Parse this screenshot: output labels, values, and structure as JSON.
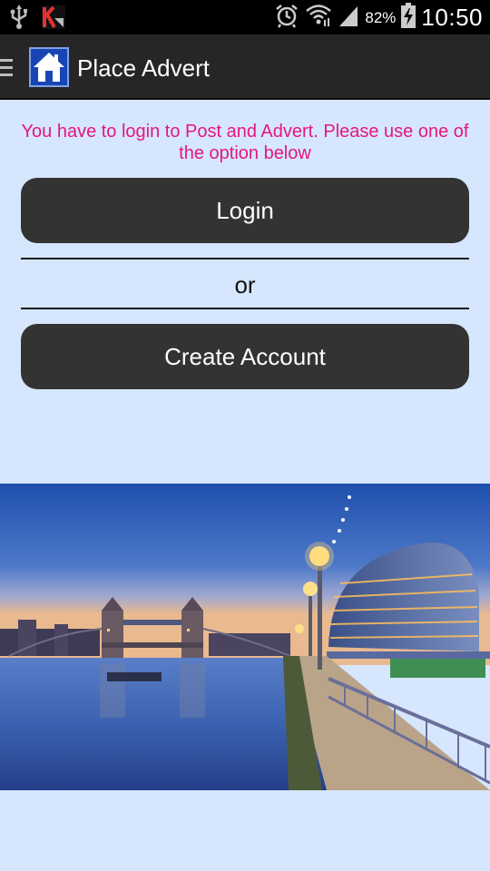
{
  "status_bar": {
    "battery_percent": "82%",
    "time": "10:50",
    "icons": [
      "usb-icon",
      "kaspersky-icon",
      "alarm-icon",
      "wifi-icon",
      "signal-icon",
      "battery-charging-icon"
    ]
  },
  "action_bar": {
    "title": "Place Advert",
    "icons": [
      "menu-icon",
      "home-icon"
    ]
  },
  "main": {
    "notice": "You have to login to Post and Advert. Please use one of the option below",
    "login_label": "Login",
    "or_label": "or",
    "create_account_label": "Create Account"
  },
  "colors": {
    "background": "#d6e6fc",
    "notice_text": "#e5177c",
    "button_bg": "#333333",
    "action_bar_bg": "#262626"
  },
  "hero": {
    "icon": "london-skyline-photo"
  }
}
